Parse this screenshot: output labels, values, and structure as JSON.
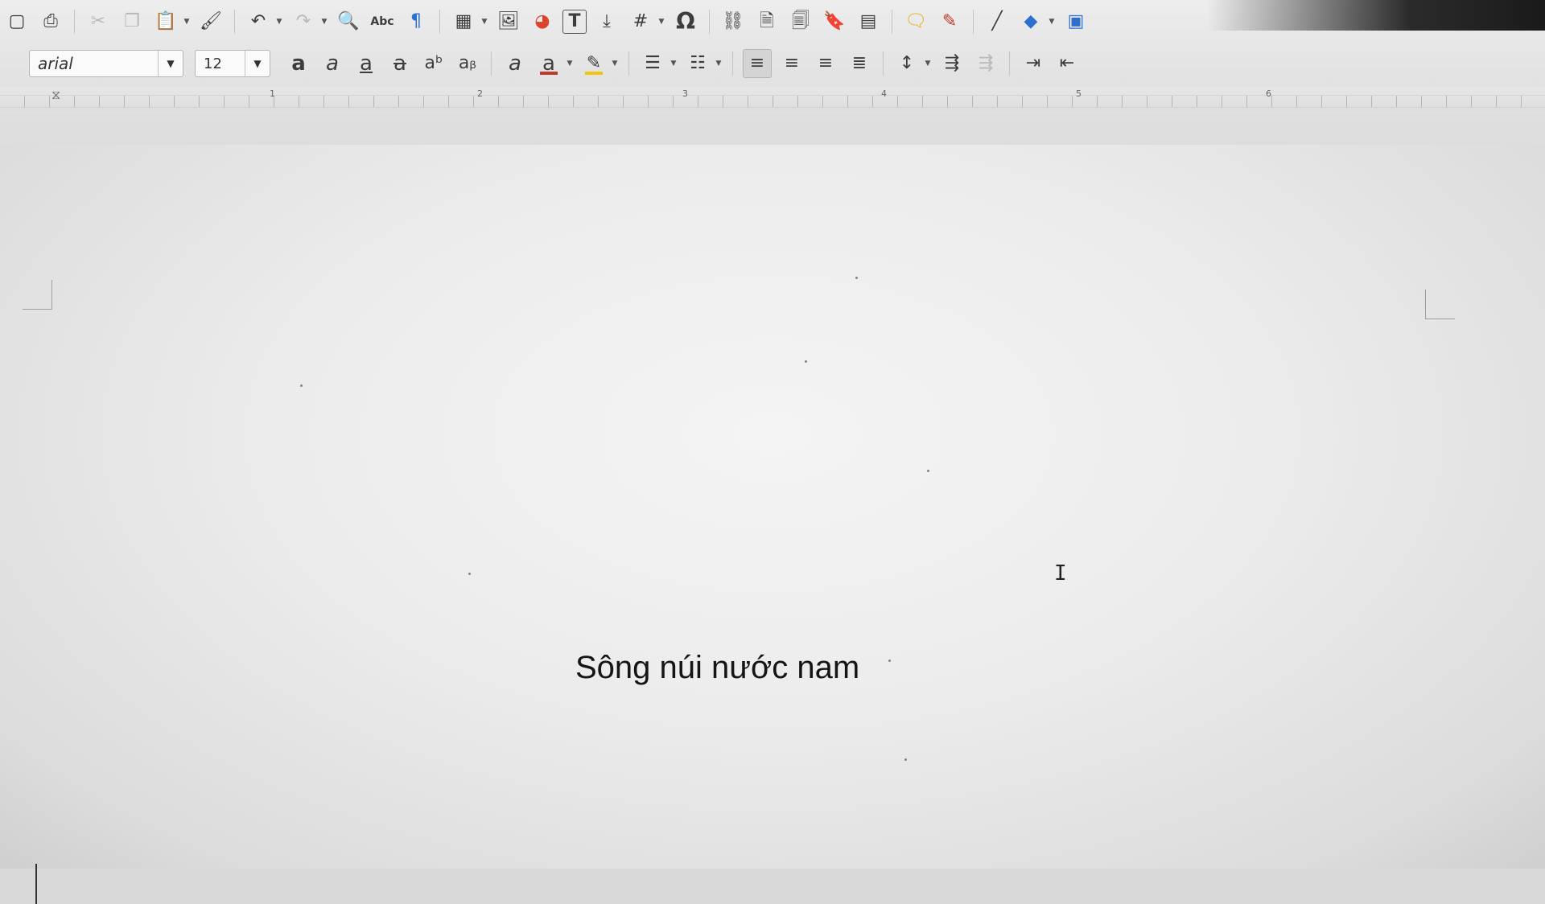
{
  "toolbar_standard": {
    "items": [
      {
        "name": "templates-icon",
        "glyph": "▢"
      },
      {
        "name": "print-preview-icon",
        "glyph": "⎙"
      },
      {
        "name": "cut-icon",
        "glyph": "✂"
      },
      {
        "name": "copy-icon",
        "glyph": "❐"
      },
      {
        "name": "paste-icon",
        "glyph": "📋"
      },
      {
        "name": "clone-formatting-icon",
        "glyph": "🖌"
      },
      {
        "name": "undo-icon",
        "glyph": "↶"
      },
      {
        "name": "redo-icon",
        "glyph": "↷"
      },
      {
        "name": "find-replace-icon",
        "glyph": "🔍"
      },
      {
        "name": "spellcheck-icon",
        "glyph": "Abc"
      },
      {
        "name": "formatting-marks-icon",
        "glyph": "¶"
      },
      {
        "name": "insert-table-icon",
        "glyph": "▦"
      },
      {
        "name": "insert-image-icon",
        "glyph": "🖼"
      },
      {
        "name": "insert-chart-icon",
        "glyph": "◕"
      },
      {
        "name": "insert-textbox-icon",
        "glyph": "T"
      },
      {
        "name": "page-break-icon",
        "glyph": "⤓"
      },
      {
        "name": "insert-field-icon",
        "glyph": "#"
      },
      {
        "name": "special-character-icon",
        "glyph": "Ω"
      },
      {
        "name": "hyperlink-icon",
        "glyph": "⛓"
      },
      {
        "name": "footnote-icon",
        "glyph": "🗎"
      },
      {
        "name": "endnote-icon",
        "glyph": "🗐"
      },
      {
        "name": "bookmark-icon",
        "glyph": "🔖"
      },
      {
        "name": "cross-reference-icon",
        "glyph": "▤"
      },
      {
        "name": "comment-icon",
        "glyph": "🗨"
      },
      {
        "name": "track-changes-icon",
        "glyph": "✎"
      },
      {
        "name": "line-icon",
        "glyph": "╱"
      },
      {
        "name": "basic-shapes-icon",
        "glyph": "◆"
      },
      {
        "name": "draw-functions-icon",
        "glyph": "▣"
      }
    ]
  },
  "toolbar_formatting": {
    "font_name": "arial",
    "font_size": "12",
    "items": [
      {
        "name": "bold-icon",
        "glyph": "a"
      },
      {
        "name": "italic-icon",
        "glyph": "a"
      },
      {
        "name": "underline-icon",
        "glyph": "a"
      },
      {
        "name": "strikethrough-icon",
        "glyph": "a"
      },
      {
        "name": "superscript-icon",
        "glyph": "aᵇ"
      },
      {
        "name": "subscript-icon",
        "glyph": "aᵦ"
      },
      {
        "name": "clear-formatting-icon",
        "glyph": "a"
      },
      {
        "name": "font-color-icon",
        "glyph": "a"
      },
      {
        "name": "highlight-color-icon",
        "glyph": "✎"
      },
      {
        "name": "unordered-list-icon",
        "glyph": "☰"
      },
      {
        "name": "ordered-list-icon",
        "glyph": "☷"
      },
      {
        "name": "align-left-icon",
        "glyph": "≡"
      },
      {
        "name": "align-center-icon",
        "glyph": "≡"
      },
      {
        "name": "align-right-icon",
        "glyph": "≡"
      },
      {
        "name": "justify-icon",
        "glyph": "≣"
      },
      {
        "name": "line-spacing-icon",
        "glyph": "↕"
      },
      {
        "name": "paragraph-spacing-icon",
        "glyph": "⇶"
      },
      {
        "name": "decrease-spacing-icon",
        "glyph": "⇶"
      },
      {
        "name": "increase-indent-icon",
        "glyph": "⇥"
      },
      {
        "name": "decrease-indent-icon",
        "glyph": "⇤"
      }
    ]
  },
  "ruler": {
    "labels": [
      "1",
      "2",
      "3",
      "4",
      "5",
      "6"
    ]
  },
  "colors": {
    "font_color": "#c0392b",
    "highlight_color": "#f1c40f",
    "basic_shape": "#2e6fce"
  },
  "document": {
    "text": "Sông núi nước nam"
  }
}
